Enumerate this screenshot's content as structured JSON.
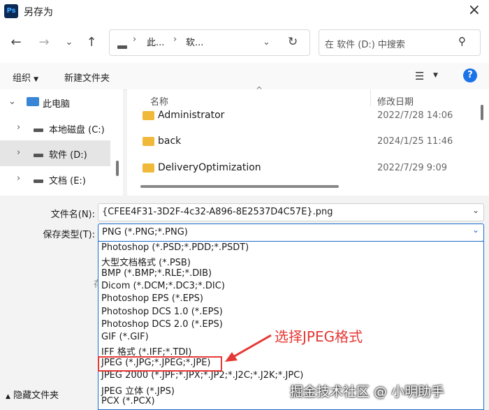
{
  "window": {
    "app_icon": "Ps",
    "title": "另存为"
  },
  "navbar": {
    "path": [
      "此...",
      "软..."
    ],
    "search_placeholder": "在 软件 (D:) 中搜索"
  },
  "toolbar": {
    "organize": "组织",
    "new_folder": "新建文件夹"
  },
  "nav_tree": [
    {
      "label": "此电脑",
      "expanded": true
    },
    {
      "label": "本地磁盘 (C:)"
    },
    {
      "label": "软件 (D:)",
      "selected": true
    },
    {
      "label": "文档 (E:)"
    }
  ],
  "columns": {
    "name": "名称",
    "modified": "修改日期"
  },
  "files": [
    {
      "name": "Administrator",
      "date": "2022/7/28 14:06"
    },
    {
      "name": "back",
      "date": "2024/1/25 11:46"
    },
    {
      "name": "DeliveryOptimization",
      "date": "2022/7/29 9:09"
    }
  ],
  "form": {
    "filename_label": "文件名(N):",
    "filename_value": "{CFEE4F31-3D2F-4c32-A896-8E2537D4C57E}.png",
    "filetype_label": "保存类型(T):",
    "filetype_value": "PNG (*.PNG;*.PNG)"
  },
  "filetype_options": [
    "Photoshop (*.PSD;*.PDD;*.PSDT)",
    "大型文档格式 (*.PSB)",
    "BMP (*.BMP;*.RLE;*.DIB)",
    "Dicom (*.DCM;*.DC3;*.DIC)",
    "Photoshop EPS (*.EPS)",
    "Photoshop DCS 1.0 (*.EPS)",
    "Photoshop DCS 2.0 (*.EPS)",
    "GIF (*.GIF)",
    "IFF 格式 (*.IFF;*.TDI)",
    "JPEG (*.JPG;*.JPEG;*.JPE)",
    "JPEG 2000 (*.JPF;*.JPX;*.JP2;*.J2C;*.J2K;*.JPC)",
    "JPEG 立体 (*.JPS)",
    "PCX (*.PCX)"
  ],
  "partial_hidden_label": "存",
  "hide_folders": "隐藏文件夹",
  "annotation": {
    "text": "选择JPEG格式",
    "color": "#e53935"
  },
  "watermark": "掘金技术社区 @ 小明助手",
  "colors": {
    "accent": "#1a6ecb",
    "highlight_border": "#e53935",
    "folder": "#f0b93a"
  }
}
